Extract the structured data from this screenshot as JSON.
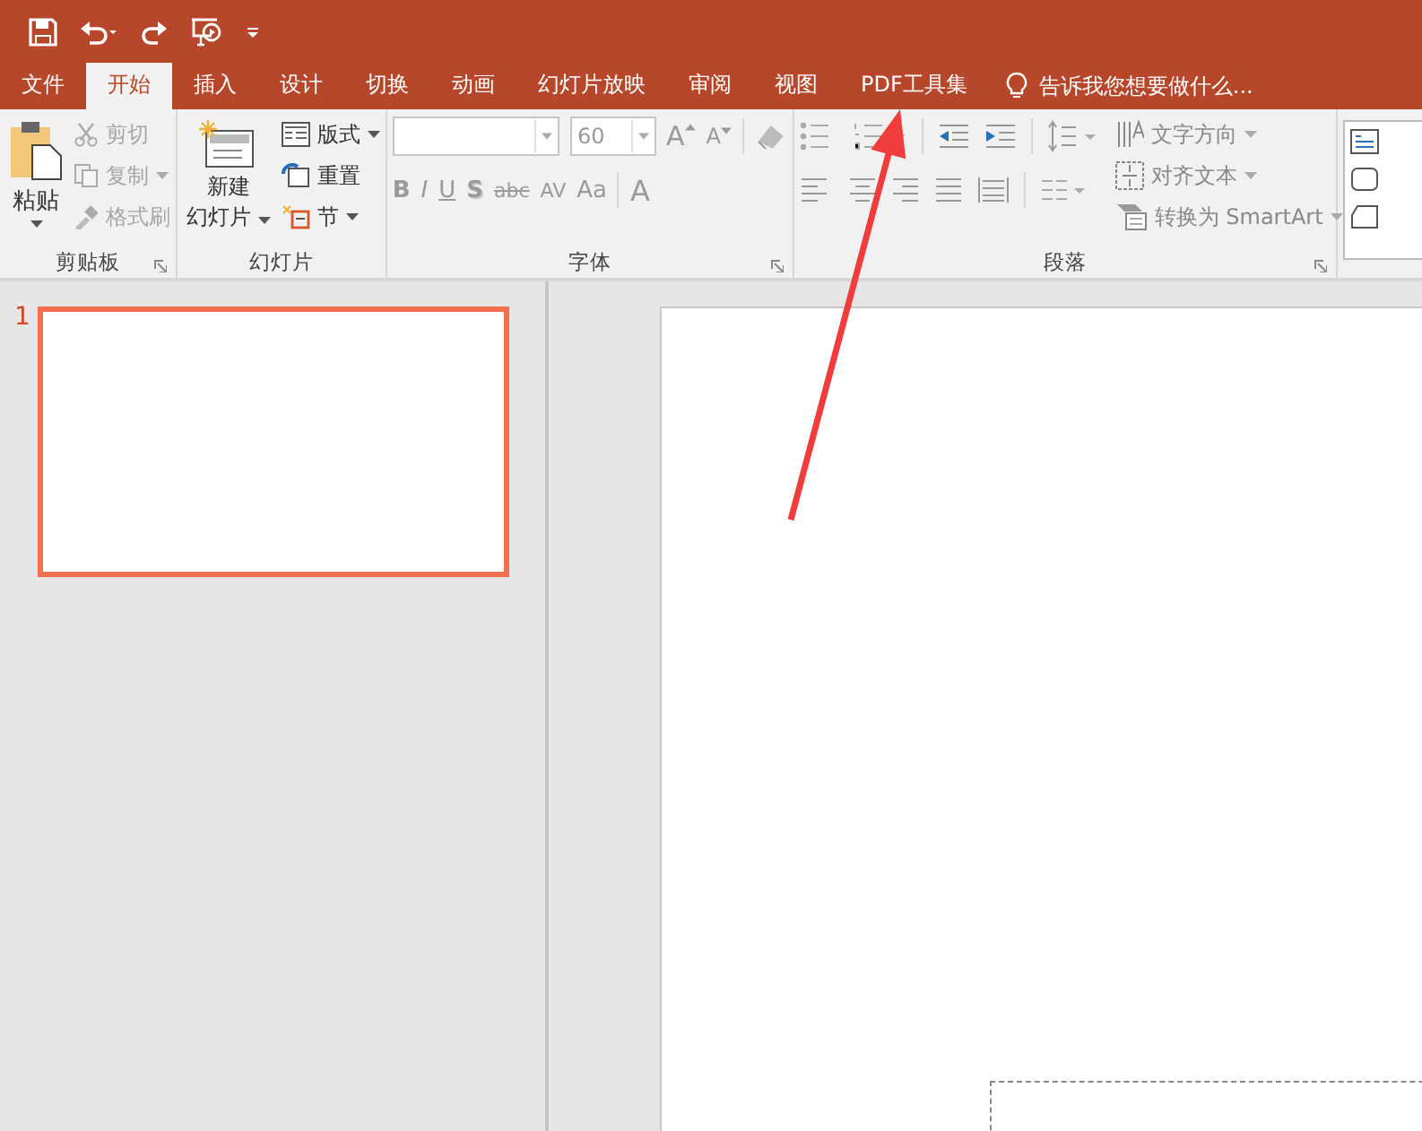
{
  "tabs": [
    {
      "label": "文件",
      "selected": false
    },
    {
      "label": "开始",
      "selected": true
    },
    {
      "label": "插入",
      "selected": false
    },
    {
      "label": "设计",
      "selected": false
    },
    {
      "label": "切换",
      "selected": false
    },
    {
      "label": "动画",
      "selected": false
    },
    {
      "label": "幻灯片放映",
      "selected": false
    },
    {
      "label": "审阅",
      "selected": false
    },
    {
      "label": "视图",
      "selected": false
    },
    {
      "label": "PDF工具集",
      "selected": false
    }
  ],
  "tell_me": "告诉我您想要做什么...",
  "clipboard": {
    "paste": "粘贴",
    "items": [
      {
        "label": "剪切",
        "kind": "cut",
        "disabled": true
      },
      {
        "label": "复制",
        "kind": "copy",
        "disabled": true
      },
      {
        "label": "格式刷",
        "kind": "brush",
        "disabled": true
      }
    ],
    "group_label": "剪贴板"
  },
  "slides_group": {
    "new_slide": [
      "新建",
      "幻灯片"
    ],
    "items": [
      {
        "label": "版式",
        "kind": "layout"
      },
      {
        "label": "重置",
        "kind": "reset"
      },
      {
        "label": "节",
        "kind": "section"
      }
    ],
    "group_label": "幻灯片"
  },
  "font": {
    "size": "60",
    "styles": [
      "B",
      "I",
      "U",
      "S",
      "abc",
      "AV",
      "Aa"
    ],
    "color_letter": "A",
    "grow": "A",
    "shrink": "A",
    "group_label": "字体"
  },
  "paragraph": {
    "commands": [
      {
        "label": "文字方向",
        "kind": "direction"
      },
      {
        "label": "对齐文本",
        "kind": "align"
      },
      {
        "label": "转换为 SmartArt",
        "kind": "smartart"
      }
    ],
    "group_label": "段落"
  },
  "slide_thumbnails": [
    {
      "number": "1",
      "selected": true
    }
  ]
}
